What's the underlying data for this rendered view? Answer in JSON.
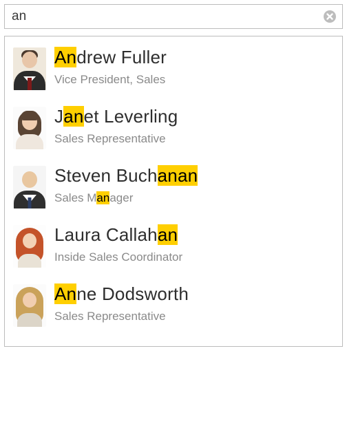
{
  "search": {
    "value": "an",
    "placeholder": ""
  },
  "highlight": "an",
  "results": [
    {
      "name": "Andrew Fuller",
      "title": "Vice President, Sales",
      "avatar": "av1"
    },
    {
      "name": "Janet Leverling",
      "title": "Sales Representative",
      "avatar": "av2"
    },
    {
      "name": "Steven Buchanan",
      "title": "Sales Manager",
      "avatar": "av3"
    },
    {
      "name": "Laura Callahan",
      "title": "Inside Sales Coordinator",
      "avatar": "av4"
    },
    {
      "name": "Anne Dodsworth",
      "title": "Sales Representative",
      "avatar": "av5"
    }
  ],
  "colors": {
    "highlight_bg": "#ffcf00",
    "border": "#bcbcbc",
    "subtext": "#8a8a8a"
  }
}
